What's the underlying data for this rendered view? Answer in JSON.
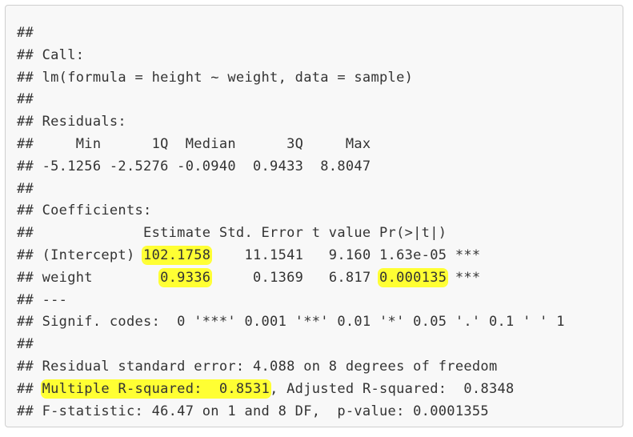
{
  "prefix": "##",
  "lines": [
    {
      "a": ""
    },
    {
      "a": " Call:"
    },
    {
      "a": " lm(formula = height ~ weight, data = sample)"
    },
    {
      "a": ""
    },
    {
      "a": " Residuals:"
    },
    {
      "a": "     Min      1Q  Median      3Q     Max"
    },
    {
      "a": " -5.1256 -2.5276 -0.0940  0.9433  8.8047"
    },
    {
      "a": ""
    },
    {
      "a": " Coefficients:"
    },
    {
      "a": "             Estimate Std. Error t value Pr(>|t|)"
    },
    {
      "a": " (Intercept) ",
      "h1": "102.1758",
      "b": "    11.1541   9.160 1.63e-05 ***"
    },
    {
      "a": " weight        ",
      "h1": "0.9336",
      "b": "     0.1369   6.817 ",
      "h2": "0.000135",
      "c": " ***"
    },
    {
      "a": " ---"
    },
    {
      "a": " Signif. codes:  0 '***' 0.001 '**' 0.01 '*' 0.05 '.' 0.1 ' ' 1"
    },
    {
      "a": ""
    },
    {
      "a": " Residual standard error: 4.088 on 8 degrees of freedom"
    },
    {
      "a": " ",
      "h1": "Multiple R-squared:  0.8531",
      "b": ", Adjusted R-squared:  0.8348"
    },
    {
      "a": " F-statistic: 46.47 on 1 and 8 DF,  p-value: 0.0001355"
    }
  ],
  "highlight_color": "#ffff33"
}
